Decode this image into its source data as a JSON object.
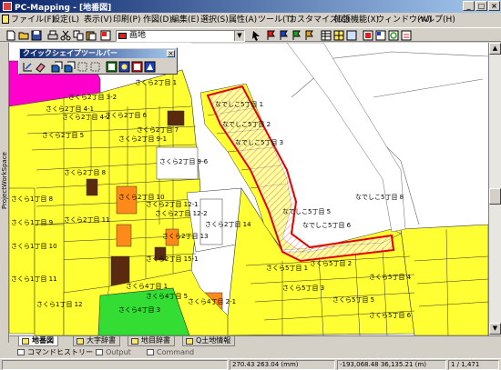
{
  "window": {
    "title": "PC-Mapping - [地番図]"
  },
  "menu": [
    "ファイル(F)",
    "設定(L)",
    "表示(V)",
    "印刷(P)",
    "作図(D)",
    "編集(E)",
    "選択(S)",
    "属性(A)",
    "ツール(T)",
    "カスタマイズ(C)",
    "拡張機能(X)",
    "ウィンドウ(W)",
    "ヘルプ(H)"
  ],
  "toolbar": {
    "layer_value": "画地"
  },
  "side_panel": {
    "label": "ProjectWorkSpace"
  },
  "quick_shape": {
    "title": "クイックシェイプツールバー"
  },
  "map": {
    "labels": [
      "さくら2丁目 1",
      "さくら2丁目 3-2",
      "さくら2丁目 4-1",
      "さくら2丁目 4-2",
      "さくら2丁目 5",
      "さくら2丁目 6",
      "さくら2丁目 7",
      "さくら2丁目 8",
      "さくら2丁目 9-1",
      "さくら2丁目 9-6",
      "さくら2丁目 10",
      "さくら2丁目 11",
      "さくら2丁目 12-1",
      "さくら2丁目 12-2",
      "さくら2丁目 13",
      "さくら2丁目 14",
      "さくら2丁目 15-1",
      "さくら1丁目 8",
      "さくら1丁目 9",
      "さくら1丁目 10",
      "さくら1丁目 11",
      "さくら1丁目 12",
      "さくら4丁目 1",
      "さくら4丁目 2-1",
      "さくら4丁目 3",
      "さくら4丁目 5",
      "さくら5丁目 1",
      "さくら5丁目 2",
      "さくら5丁目 3",
      "さくら5丁目 4",
      "さくら5丁目 5",
      "さくら5丁目 6",
      "なでしこ5丁目 1",
      "なでしこ5丁目 2",
      "なでしこ5丁目 3",
      "なでしこ5丁目 5",
      "なでしこ5丁目 6",
      "なでしこ5丁目 8"
    ]
  },
  "map_tabs": [
    "地番図",
    "大字辞書",
    "地目辞書",
    "Q土地情報"
  ],
  "bottom_tabs": [
    "コマンドヒストリー",
    "Output",
    "Command"
  ],
  "status": {
    "coords_mm": "270.43 263.04 (mm)",
    "coords_world": "-193,068.48 36,135.21 (m)",
    "scale": "1 / 1,471"
  },
  "colors": {
    "parcel_yellow": "#ffff33",
    "parcel_orange": "#ff8a1a",
    "parcel_brown": "#5a2a10",
    "parcel_green": "#33dd33",
    "parcel_magenta": "#ff00cc",
    "selection": "#e00000"
  }
}
